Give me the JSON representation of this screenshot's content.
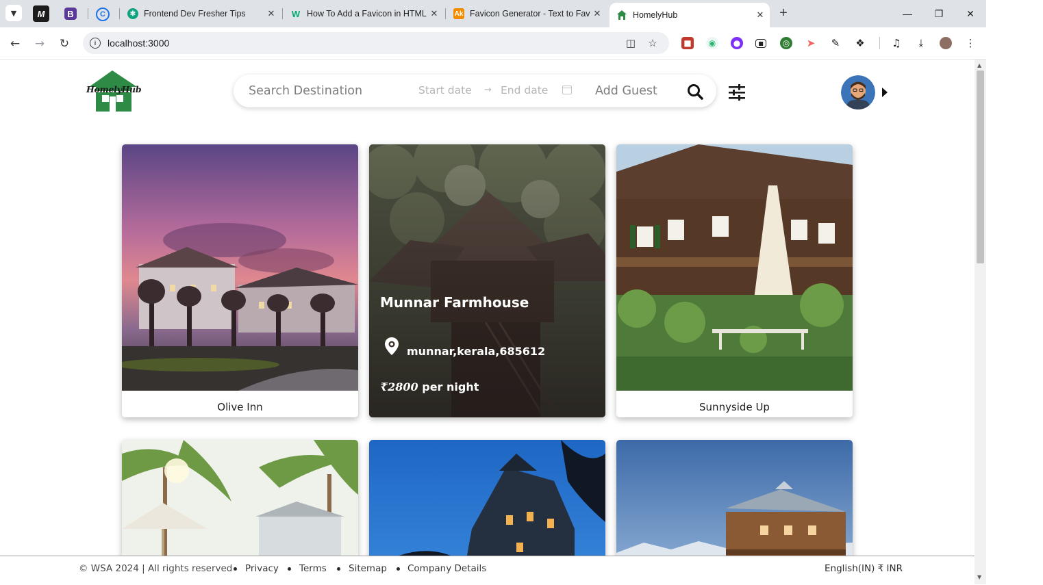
{
  "browser": {
    "tabs": [
      {
        "title": "Frontend Dev Fresher Tips",
        "favicon": "chatgpt-icon"
      },
      {
        "title": "How To Add a Favicon in HTML",
        "favicon": "w3-icon"
      },
      {
        "title": "Favicon Generator - Text to Favi",
        "favicon": "favicon-generator-icon"
      },
      {
        "title": "HomelyHub",
        "favicon": "home-icon",
        "active": true
      }
    ],
    "pinned_tabs": [
      "M",
      "B",
      "C"
    ],
    "url": "localhost:3000"
  },
  "header": {
    "logo_text": "HomelyHub",
    "search": {
      "destination_placeholder": "Search Destination",
      "start_date_placeholder": "Start date",
      "end_date_placeholder": "End date",
      "guest_placeholder": "Add Guest"
    }
  },
  "listings": [
    {
      "name": "Olive Inn"
    },
    {
      "name": "Munnar Farmhouse",
      "location": "munnar,kerala,685612",
      "price_symbol": "₹2800",
      "price_suffix": "per night",
      "hovered": true
    },
    {
      "name": "Sunnyside Up"
    },
    {
      "name": ""
    },
    {
      "name": ""
    },
    {
      "name": ""
    }
  ],
  "footer": {
    "copyright": "© WSA 2024 | All rights reserved",
    "links": [
      "Privacy",
      "Terms",
      "Sitemap",
      "Company Details"
    ],
    "locale": "English(IN)  ₹ INR"
  },
  "colors": {
    "brand_green": "#2e8b45",
    "text_dark": "#1f1f1f"
  }
}
